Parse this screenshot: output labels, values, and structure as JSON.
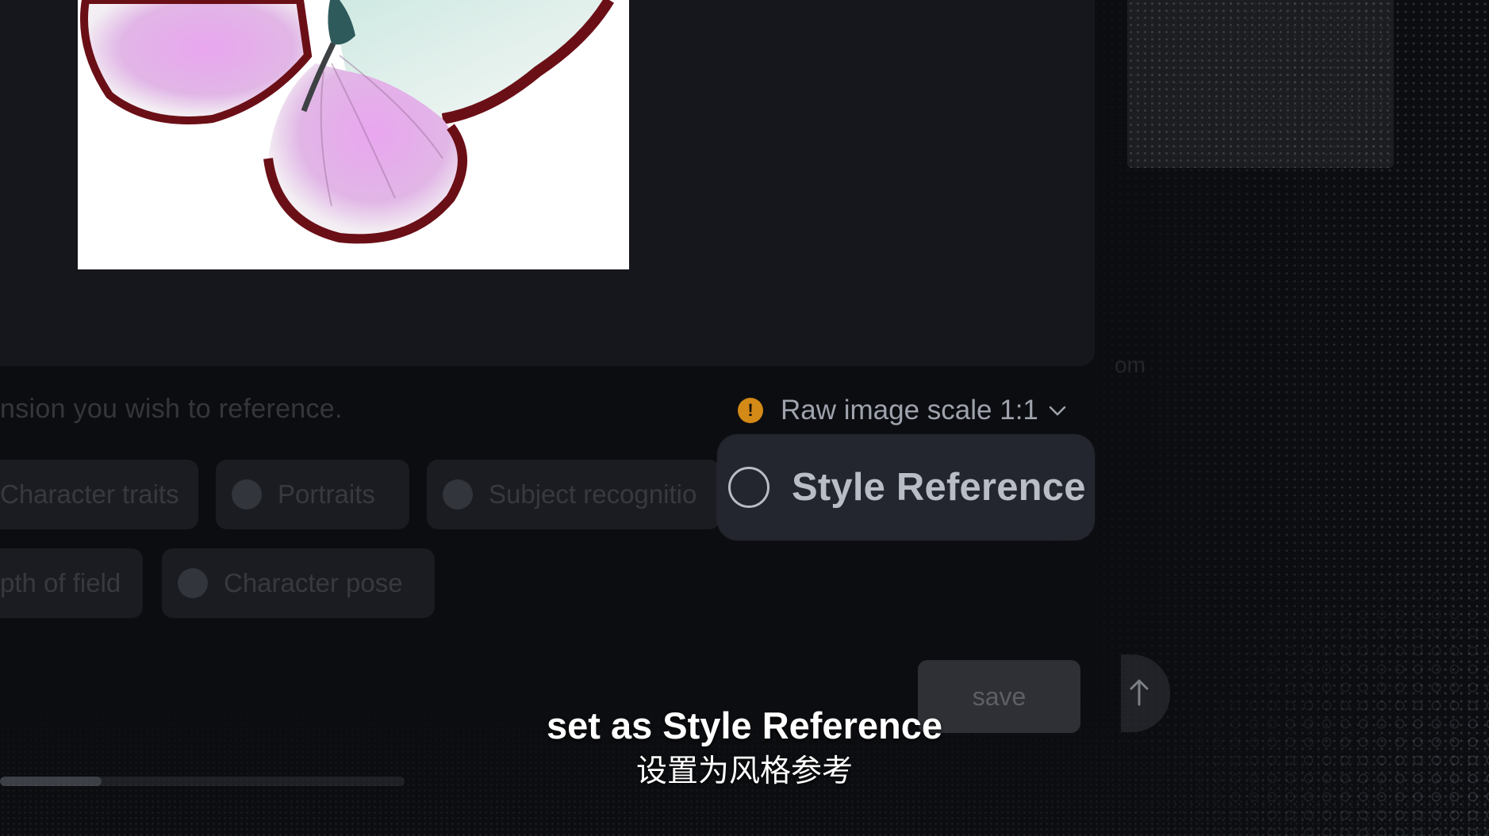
{
  "reference_panel": {
    "image_name": "butterfly-reference-image",
    "right_hint_text": "om"
  },
  "description_text": "nsion you wish to reference.",
  "scale_control": {
    "warning_icon": "warning-icon",
    "label": "Raw image scale 1:1",
    "chevron_icon": "chevron-down-icon"
  },
  "reference_options": {
    "row1": [
      {
        "label": "Character traits"
      },
      {
        "label": "Portraits"
      },
      {
        "label": "Subject recognitio"
      }
    ],
    "row2": [
      {
        "label": "pth of field"
      },
      {
        "label": "Character pose"
      }
    ],
    "selected": {
      "label": "Style Reference",
      "checked": false
    }
  },
  "actions": {
    "save_label": "save",
    "send_icon": "arrow-up-icon"
  },
  "progress": {
    "value": 0.25
  },
  "subtitles": {
    "english": "set as Style Reference",
    "chinese": "设置为风格参考"
  },
  "colors": {
    "warning": "#d38a16",
    "chip_highlight": "#23262e",
    "panel": "#15171c"
  }
}
